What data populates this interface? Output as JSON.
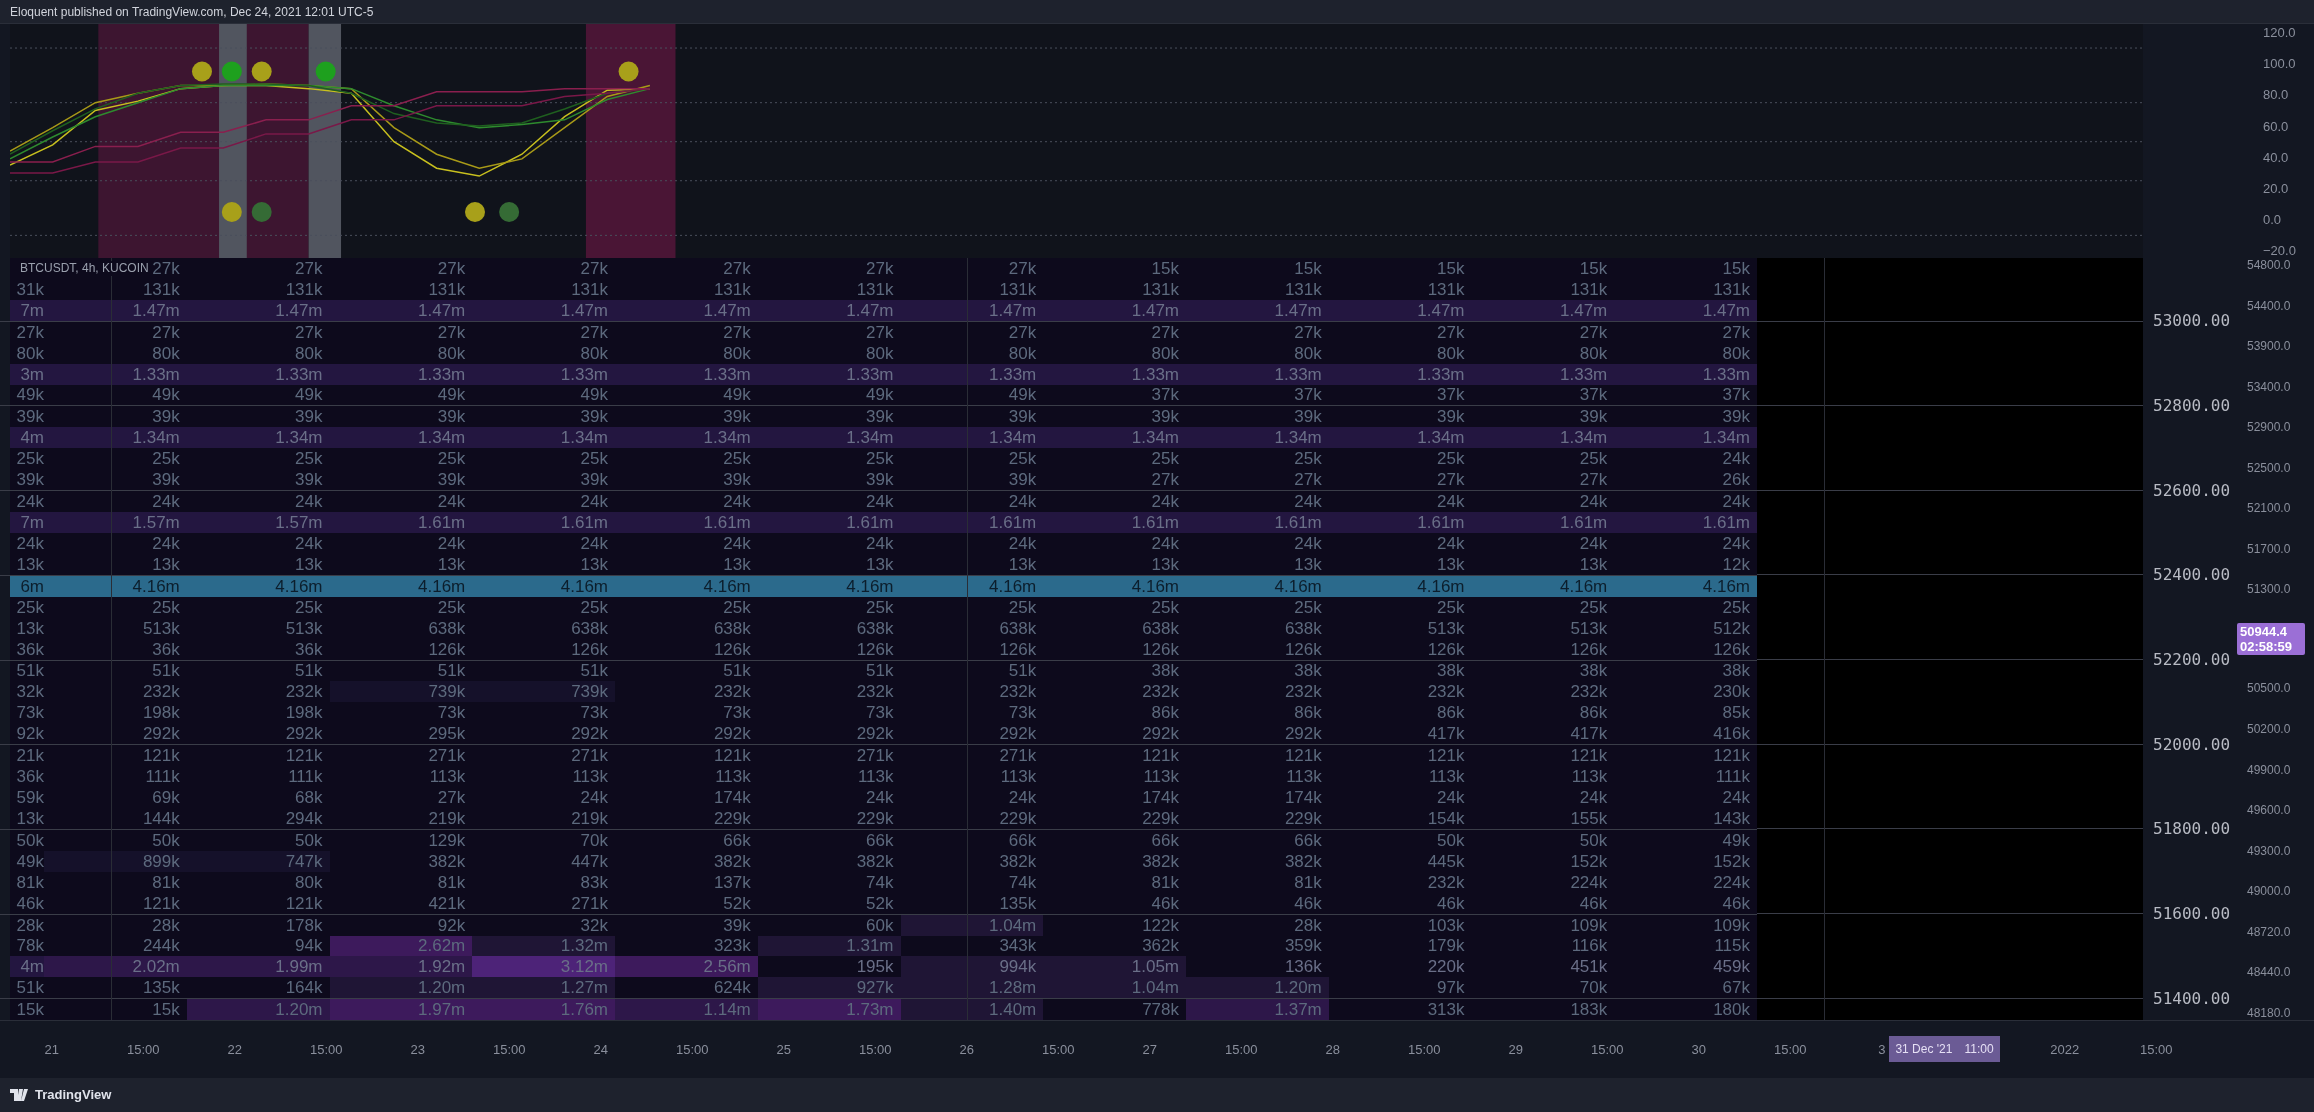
{
  "header": {
    "title": "Eloquent published on TradingView.com, Dec 24, 2021 12:01 UTC-5"
  },
  "oscillator": {
    "axis_labels": [
      "120.0",
      "100.0",
      "80.0",
      "60.0",
      "40.0",
      "20.0",
      "0.0",
      "−20.0"
    ]
  },
  "symbol_label": "BTCUSDT, 4h, KUCOIN",
  "rows": [
    {
      "kind": "plain",
      "cells": [
        "27k",
        "27k",
        "27k",
        "27k",
        "27k",
        "27k",
        "27k",
        "15k",
        "15k",
        "15k",
        "15k",
        "15k"
      ]
    },
    {
      "kind": "plain",
      "edge": "31k",
      "cells": [
        "131k",
        "131k",
        "131k",
        "131k",
        "131k",
        "131k",
        "131k",
        "131k",
        "131k",
        "131k",
        "131k",
        "131k"
      ]
    },
    {
      "kind": "band",
      "edge": "7m",
      "cells": [
        "1.47m",
        "1.47m",
        "1.47m",
        "1.47m",
        "1.47m",
        "1.47m",
        "1.47m",
        "1.47m",
        "1.47m",
        "1.47m",
        "1.47m",
        "1.47m"
      ]
    },
    {
      "kind": "plain",
      "edge": "27k",
      "cells": [
        "27k",
        "27k",
        "27k",
        "27k",
        "27k",
        "27k",
        "27k",
        "27k",
        "27k",
        "27k",
        "27k",
        "27k"
      ]
    },
    {
      "kind": "plain",
      "edge": "80k",
      "cells": [
        "80k",
        "80k",
        "80k",
        "80k",
        "80k",
        "80k",
        "80k",
        "80k",
        "80k",
        "80k",
        "80k",
        "80k"
      ]
    },
    {
      "kind": "band",
      "edge": "3m",
      "cells": [
        "1.33m",
        "1.33m",
        "1.33m",
        "1.33m",
        "1.33m",
        "1.33m",
        "1.33m",
        "1.33m",
        "1.33m",
        "1.33m",
        "1.33m",
        "1.33m"
      ]
    },
    {
      "kind": "plain",
      "edge": "49k",
      "cells": [
        "49k",
        "49k",
        "49k",
        "49k",
        "49k",
        "49k",
        "49k",
        "37k",
        "37k",
        "37k",
        "37k",
        "37k"
      ]
    },
    {
      "kind": "plain",
      "edge": "39k",
      "cells": [
        "39k",
        "39k",
        "39k",
        "39k",
        "39k",
        "39k",
        "39k",
        "39k",
        "39k",
        "39k",
        "39k",
        "39k"
      ]
    },
    {
      "kind": "band",
      "edge": "4m",
      "cells": [
        "1.34m",
        "1.34m",
        "1.34m",
        "1.34m",
        "1.34m",
        "1.34m",
        "1.34m",
        "1.34m",
        "1.34m",
        "1.34m",
        "1.34m",
        "1.34m"
      ]
    },
    {
      "kind": "plain",
      "edge": "25k",
      "cells": [
        "25k",
        "25k",
        "25k",
        "25k",
        "25k",
        "25k",
        "25k",
        "25k",
        "25k",
        "25k",
        "25k",
        "24k"
      ]
    },
    {
      "kind": "plain",
      "edge": "39k",
      "cells": [
        "39k",
        "39k",
        "39k",
        "39k",
        "39k",
        "39k",
        "39k",
        "27k",
        "27k",
        "27k",
        "27k",
        "26k"
      ]
    },
    {
      "kind": "plain",
      "edge": "24k",
      "cells": [
        "24k",
        "24k",
        "24k",
        "24k",
        "24k",
        "24k",
        "24k",
        "24k",
        "24k",
        "24k",
        "24k",
        "24k"
      ]
    },
    {
      "kind": "band",
      "edge": "7m",
      "cells": [
        "1.57m",
        "1.57m",
        "1.61m",
        "1.61m",
        "1.61m",
        "1.61m",
        "1.61m",
        "1.61m",
        "1.61m",
        "1.61m",
        "1.61m",
        "1.61m"
      ]
    },
    {
      "kind": "plain",
      "edge": "24k",
      "cells": [
        "24k",
        "24k",
        "24k",
        "24k",
        "24k",
        "24k",
        "24k",
        "24k",
        "24k",
        "24k",
        "24k",
        "24k"
      ]
    },
    {
      "kind": "plain",
      "edge": "13k",
      "cells": [
        "13k",
        "13k",
        "13k",
        "13k",
        "13k",
        "13k",
        "13k",
        "13k",
        "13k",
        "13k",
        "13k",
        "12k"
      ]
    },
    {
      "kind": "current",
      "edge": "6m",
      "cells": [
        "4.16m",
        "4.16m",
        "4.16m",
        "4.16m",
        "4.16m",
        "4.16m",
        "4.16m",
        "4.16m",
        "4.16m",
        "4.16m",
        "4.16m",
        "4.16m"
      ]
    },
    {
      "kind": "plain",
      "edge": "25k",
      "cells": [
        "25k",
        "25k",
        "25k",
        "25k",
        "25k",
        "25k",
        "25k",
        "25k",
        "25k",
        "25k",
        "25k",
        "25k"
      ]
    },
    {
      "kind": "plain",
      "edge": "13k",
      "cells": [
        "513k",
        "513k",
        "638k",
        "638k",
        "638k",
        "638k",
        "638k",
        "638k",
        "638k",
        "513k",
        "513k",
        "512k"
      ]
    },
    {
      "kind": "plain",
      "edge": "36k",
      "cells": [
        "36k",
        "36k",
        "126k",
        "126k",
        "126k",
        "126k",
        "126k",
        "126k",
        "126k",
        "126k",
        "126k",
        "126k"
      ]
    },
    {
      "kind": "plain",
      "edge": "51k",
      "cells": [
        "51k",
        "51k",
        "51k",
        "51k",
        "51k",
        "51k",
        "51k",
        "38k",
        "38k",
        "38k",
        "38k",
        "38k"
      ]
    },
    {
      "kind": "plain",
      "edge": "32k",
      "cells": [
        "232k",
        "232k",
        {
          "text": "739k",
          "color": "#15112a"
        },
        {
          "text": "739k",
          "color": "#15112a"
        },
        "232k",
        "232k",
        "232k",
        "232k",
        "232k",
        "232k",
        "232k",
        "230k"
      ]
    },
    {
      "kind": "plain",
      "edge": "73k",
      "cells": [
        "198k",
        "198k",
        "73k",
        "73k",
        "73k",
        "73k",
        "73k",
        "86k",
        "86k",
        "86k",
        "86k",
        "85k"
      ]
    },
    {
      "kind": "plain",
      "edge": "92k",
      "cells": [
        "292k",
        "292k",
        "295k",
        "292k",
        "292k",
        "292k",
        "292k",
        "292k",
        "292k",
        "417k",
        "417k",
        "416k"
      ]
    },
    {
      "kind": "plain",
      "edge": "21k",
      "cells": [
        "121k",
        "121k",
        "271k",
        "271k",
        "121k",
        "271k",
        "271k",
        "121k",
        "121k",
        "121k",
        "121k",
        "121k"
      ]
    },
    {
      "kind": "plain",
      "edge": "36k",
      "cells": [
        "111k",
        "111k",
        "113k",
        "113k",
        "113k",
        "113k",
        "113k",
        "113k",
        "113k",
        "113k",
        "113k",
        "111k"
      ]
    },
    {
      "kind": "plain",
      "edge": "59k",
      "cells": [
        "69k",
        "68k",
        "27k",
        "24k",
        "174k",
        "24k",
        "24k",
        "174k",
        "174k",
        "24k",
        "24k",
        "24k"
      ]
    },
    {
      "kind": "plain",
      "edge": "13k",
      "cells": [
        "144k",
        "294k",
        "219k",
        "219k",
        "229k",
        "229k",
        "229k",
        "229k",
        "229k",
        "154k",
        "155k",
        "143k"
      ]
    },
    {
      "kind": "plain",
      "edge": "50k",
      "cells": [
        "50k",
        "50k",
        "129k",
        "70k",
        "66k",
        "66k",
        "66k",
        "66k",
        "66k",
        "50k",
        "50k",
        "49k"
      ]
    },
    {
      "kind": "plain",
      "edge": "49k",
      "cells": [
        {
          "text": "899k",
          "color": "#15112a"
        },
        {
          "text": "747k",
          "color": "#15112a"
        },
        "382k",
        "447k",
        "382k",
        "382k",
        "382k",
        "382k",
        "382k",
        "445k",
        "152k",
        "152k"
      ]
    },
    {
      "kind": "plain",
      "edge": "81k",
      "cells": [
        "81k",
        "80k",
        "81k",
        "83k",
        "137k",
        "74k",
        "74k",
        "81k",
        "81k",
        "232k",
        "224k",
        "224k"
      ]
    },
    {
      "kind": "plain",
      "edge": "46k",
      "cells": [
        "121k",
        "121k",
        "421k",
        "271k",
        "52k",
        "52k",
        "135k",
        "46k",
        "46k",
        "46k",
        "46k",
        "46k"
      ]
    },
    {
      "kind": "plain",
      "edge": "28k",
      "cells": [
        "28k",
        "178k",
        "92k",
        "32k",
        "39k",
        "60k",
        {
          "text": "1.04m",
          "color": "#1f1535"
        },
        "122k",
        "28k",
        "103k",
        "109k",
        "109k"
      ]
    },
    {
      "kind": "plain",
      "edge": "78k",
      "cells": [
        "244k",
        "94k",
        {
          "text": "2.62m",
          "color": "#3d1a5c"
        },
        {
          "text": "1.32m",
          "color": "#1f1535"
        },
        "323k",
        {
          "text": "1.31m",
          "color": "#1f1535"
        },
        "343k",
        "362k",
        "359k",
        "179k",
        "116k",
        "115k"
      ]
    },
    {
      "kind": "band",
      "edge": "4m",
      "cells": [
        {
          "text": "2.02m",
          "color": "#2d1749"
        },
        {
          "text": "1.99m",
          "color": "#2d1749"
        },
        {
          "text": "1.92m",
          "color": "#2d1749"
        },
        {
          "text": "3.12m",
          "color": "#4d2378"
        },
        {
          "text": "2.56m",
          "color": "#3d1a5c"
        },
        {
          "text": "195k",
          "color": "#0d0a1c"
        },
        {
          "text": "994k",
          "color": "#1f1535"
        },
        {
          "text": "1.05m",
          "color": "#1f1535"
        },
        {
          "text": "136k",
          "color": "#0d0a1c"
        },
        {
          "text": "220k",
          "color": "#0d0a1c"
        },
        {
          "text": "451k",
          "color": "#0d0a1c"
        },
        {
          "text": "459k",
          "color": "#0d0a1c"
        }
      ]
    },
    {
      "kind": "plain",
      "edge": "51k",
      "cells": [
        "135k",
        "164k",
        {
          "text": "1.20m",
          "color": "#1f1535"
        },
        {
          "text": "1.27m",
          "color": "#1f1535"
        },
        "624k",
        {
          "text": "927k",
          "color": "#1f1535"
        },
        {
          "text": "1.28m",
          "color": "#1f1535"
        },
        {
          "text": "1.04m",
          "color": "#1f1535"
        },
        {
          "text": "1.20m",
          "color": "#1f1535"
        },
        "97k",
        "70k",
        "67k"
      ]
    },
    {
      "kind": "plain",
      "edge": "15k",
      "cells": [
        "15k",
        {
          "text": "1.20m",
          "color": "#2d1749"
        },
        {
          "text": "1.97m",
          "color": "#3d1a5c"
        },
        {
          "text": "1.76m",
          "color": "#3d1a5c"
        },
        {
          "text": "1.14m",
          "color": "#2d1749"
        },
        {
          "text": "1.73m",
          "color": "#3d1a5c"
        },
        {
          "text": "1.40m",
          "color": "#1f1535"
        },
        "778k",
        {
          "text": "1.37m",
          "color": "#2d1749"
        },
        "313k",
        "183k",
        "180k"
      ]
    }
  ],
  "price_axis": [
    "53000.00",
    "52800.00",
    "52600.00",
    "52400.00",
    "52200.00",
    "52000.00",
    "51800.00",
    "51600.00",
    "51400.00"
  ],
  "price_axis_2": [
    {
      "kind": "tick",
      "text": "54800.0"
    },
    {
      "kind": "tick",
      "text": "54400.0"
    },
    {
      "kind": "tick",
      "text": "53900.0"
    },
    {
      "kind": "tick",
      "text": "53400.0"
    },
    {
      "kind": "tick",
      "text": "52900.0"
    },
    {
      "kind": "tick",
      "text": "52500.0"
    },
    {
      "kind": "tick",
      "text": "52100.0"
    },
    {
      "kind": "tick",
      "text": "51700.0"
    },
    {
      "kind": "tick",
      "text": "51300.0"
    },
    {
      "kind": "badge",
      "text": "50944.4",
      "time": "02:58:59"
    },
    {
      "kind": "tick",
      "text": "50500.0"
    },
    {
      "kind": "tick",
      "text": "50200.0"
    },
    {
      "kind": "tick",
      "text": "49900.0"
    },
    {
      "kind": "tick",
      "text": "49600.0"
    },
    {
      "kind": "tick",
      "text": "49300.0"
    },
    {
      "kind": "tick",
      "text": "49000.0"
    },
    {
      "kind": "tick",
      "text": "48720.0"
    },
    {
      "kind": "tick",
      "text": "48440.0"
    },
    {
      "kind": "tick",
      "text": "48180.0"
    }
  ],
  "time_axis": [
    {
      "kind": "tick",
      "text": "21"
    },
    {
      "kind": "tick",
      "text": "15:00"
    },
    {
      "kind": "tick",
      "text": "22"
    },
    {
      "kind": "tick",
      "text": "15:00"
    },
    {
      "kind": "tick",
      "text": "23"
    },
    {
      "kind": "tick",
      "text": "15:00"
    },
    {
      "kind": "tick",
      "text": "24"
    },
    {
      "kind": "tick",
      "text": "15:00"
    },
    {
      "kind": "tick",
      "text": "25"
    },
    {
      "kind": "tick",
      "text": "15:00"
    },
    {
      "kind": "tick",
      "text": "26"
    },
    {
      "kind": "tick",
      "text": "15:00"
    },
    {
      "kind": "tick",
      "text": "27"
    },
    {
      "kind": "tick",
      "text": "15:00"
    },
    {
      "kind": "tick",
      "text": "28"
    },
    {
      "kind": "tick",
      "text": "15:00"
    },
    {
      "kind": "tick",
      "text": "29"
    },
    {
      "kind": "tick",
      "text": "15:00"
    },
    {
      "kind": "tick",
      "text": "30"
    },
    {
      "kind": "tick",
      "text": "15:00"
    },
    {
      "kind": "tick",
      "text": "3"
    },
    {
      "kind": "badge",
      "text": "31 Dec '21",
      "time": "11:00"
    },
    {
      "kind": "tick",
      "text": "2022"
    },
    {
      "kind": "tick",
      "text": "15:00"
    }
  ],
  "footer": {
    "brand": "TradingView"
  }
}
